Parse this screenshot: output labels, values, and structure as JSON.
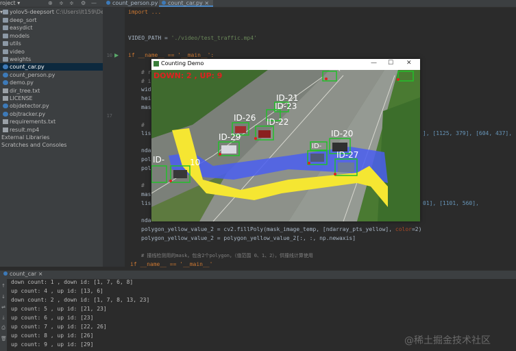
{
  "topbar": {
    "project_label": "roject ▾",
    "tabs": [
      {
        "label": "count_person.py",
        "active": false
      },
      {
        "label": "count_car.py",
        "active": true
      }
    ]
  },
  "project": {
    "root": "yolov5-deepsort",
    "root_path": "C:\\Users\\lt159\\Desktop",
    "items": [
      {
        "label": "deep_sort",
        "kind": "folder"
      },
      {
        "label": "easydict",
        "kind": "folder"
      },
      {
        "label": "models",
        "kind": "folder"
      },
      {
        "label": "utils",
        "kind": "folder"
      },
      {
        "label": "video",
        "kind": "folder"
      },
      {
        "label": "weights",
        "kind": "folder"
      },
      {
        "label": "count_car.py",
        "kind": "py",
        "selected": true
      },
      {
        "label": "count_person.py",
        "kind": "py"
      },
      {
        "label": "demo.py",
        "kind": "py"
      },
      {
        "label": "dir_tree.txt",
        "kind": "file"
      },
      {
        "label": "LICENSE",
        "kind": "file"
      },
      {
        "label": "objdetector.py",
        "kind": "py"
      },
      {
        "label": "objtracker.py",
        "kind": "py"
      },
      {
        "label": "requirements.txt",
        "kind": "file"
      },
      {
        "label": "result.mp4",
        "kind": "file"
      },
      {
        "label": "External Libraries",
        "kind": "lib"
      },
      {
        "label": "Scratches and Consoles",
        "kind": "lib"
      }
    ]
  },
  "editor": {
    "line_numbers": [
      "",
      "",
      "",
      "",
      "",
      "10",
      "",
      "",
      "",
      "",
      "",
      "",
      "17",
      "",
      "",
      "",
      "",
      "",
      "",
      "",
      "",
      "",
      "",
      "",
      "",
      "",
      "",
      "",
      "",
      "",
      "",
      ""
    ],
    "code": {
      "import": "import ...",
      "video_path_var": "VIDEO_PATH",
      "video_path_eq": " = ",
      "video_path_val": "'./video/test_traffic.mp4'",
      "if_main": "if __name__ == '__main__':",
      "c1": "# r",
      "c2": "# i",
      "wid": "wid",
      "hei": "hei",
      "mas": "mas",
      "c3": "# ",
      "lis": "lis",
      "lis_tail": "], [1125, 379], [604, 437],",
      "nda": "nda",
      "pol1": "pol",
      "pol2": "pol",
      "c4": "# ",
      "mas2": "mas",
      "lis2": "lis",
      "lis2_tail": "01], [1101, 560],",
      "nda2": "nda",
      "poly_line1_a": "polygon_yellow_value_2 = cv2.fillPoly(mask_image_temp, [ndarray_pts_yellow], ",
      "poly_line1_prm": "color",
      "poly_line1_b": "=2)",
      "poly_line2": "polygon_yellow_value_2 = polygon_yellow_value_2[:, :, np.newaxis]",
      "c5": "# 撞线检测用的mask，包含2个polygon，（值范围 0、1、2），供撞线计算使用",
      "bottom_if": "if __name__ == '__main__'"
    }
  },
  "demo_window": {
    "title": "Counting Demo",
    "overlay_text": "DOWN: 2 , UP: 9",
    "ids": [
      "ID-21",
      "ID-23",
      "ID-26",
      "ID-22",
      "ID-29",
      "ID-20",
      "ID-27",
      "ID-",
      "10"
    ]
  },
  "run": {
    "title": "count_car",
    "lines": [
      "down count: 1 , down id: [1, 7, 6, 8]",
      "up count: 4 , up id: [13, 6]",
      "down count: 2 , down id: [1, 7, 8, 13, 23]",
      "up count: 5 , up id: [21, 23]",
      "up count: 6 , up id: [23]",
      "up count: 7 , up id: [22, 26]",
      "up count: 8 , up id: [26]",
      "up count: 9 , up id: [29]"
    ]
  },
  "watermark": "@稀土掘金技术社区",
  "colors": {
    "accent": "#4a88c7",
    "yellow": "#f5e632",
    "blue": "#4a5ef0",
    "box": "#22c02a"
  }
}
